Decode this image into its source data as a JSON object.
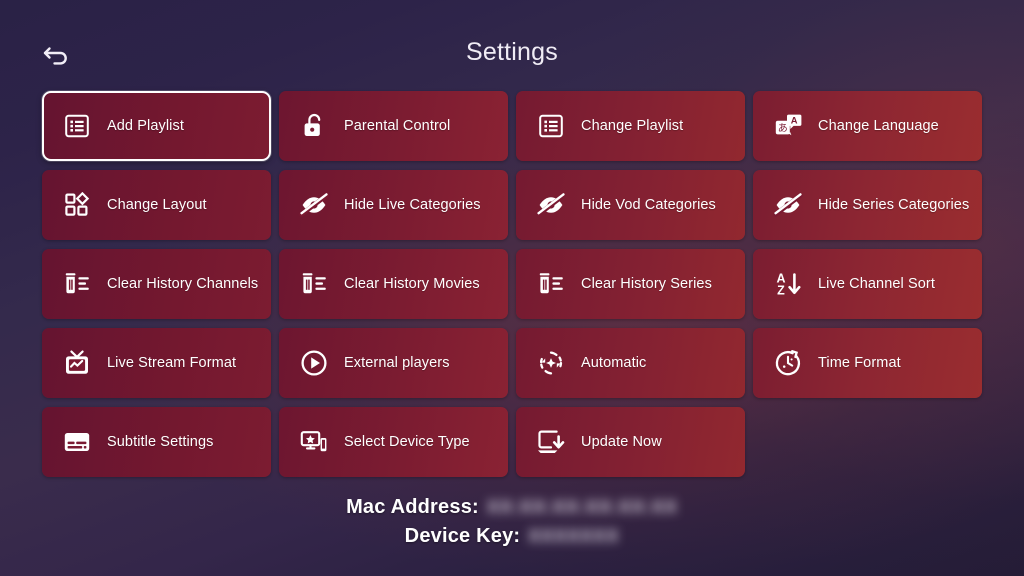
{
  "header": {
    "title": "Settings",
    "back_icon": "back-arrow-icon"
  },
  "grid": {
    "focused_index": 0,
    "items": [
      {
        "label": "Add Playlist",
        "icon": "playlist-list-icon",
        "focused": true
      },
      {
        "label": "Parental Control",
        "icon": "open-padlock-icon",
        "focused": false
      },
      {
        "label": "Change Playlist",
        "icon": "playlist-list-icon",
        "focused": false
      },
      {
        "label": "Change Language",
        "icon": "translate-icon",
        "focused": false
      },
      {
        "label": "Change Layout",
        "icon": "grid-layout-icon",
        "focused": false
      },
      {
        "label": "Hide Live Categories",
        "icon": "eye-off-icon",
        "focused": false
      },
      {
        "label": "Hide Vod Categories",
        "icon": "eye-off-icon",
        "focused": false
      },
      {
        "label": "Hide Series Categories",
        "icon": "eye-off-icon",
        "focused": false
      },
      {
        "label": "Clear History Channels",
        "icon": "trash-list-icon",
        "focused": false
      },
      {
        "label": "Clear History Movies",
        "icon": "trash-list-icon",
        "focused": false
      },
      {
        "label": "Clear History Series",
        "icon": "trash-list-icon",
        "focused": false
      },
      {
        "label": "Live Channel Sort",
        "icon": "sort-alpha-down-icon",
        "focused": false
      },
      {
        "label": "Live Stream Format",
        "icon": "tv-icon",
        "focused": false
      },
      {
        "label": "External players",
        "icon": "play-circle-icon",
        "focused": false
      },
      {
        "label": "Automatic",
        "icon": "auto-refresh-icon",
        "focused": false
      },
      {
        "label": "Time Format",
        "icon": "timer-icon",
        "focused": false
      },
      {
        "label": "Subtitle Settings",
        "icon": "subtitle-icon",
        "focused": false
      },
      {
        "label": "Select Device Type",
        "icon": "devices-star-icon",
        "focused": false
      },
      {
        "label": "Update Now",
        "icon": "download-install-icon",
        "focused": false
      }
    ]
  },
  "device_info": {
    "mac_address_label": "Mac Address:",
    "mac_address_value": "XX:XX:XX:XX:XX:XX",
    "device_key_label": "Device Key:",
    "device_key_value": "XXXXXXX"
  },
  "colors": {
    "tile_base": "#7a1a32",
    "tile_accent": "#9a2d2f",
    "focus_outline": "#ffffff",
    "text": "#ffffff",
    "background_start": "#2a2246",
    "background_end": "#241c36"
  }
}
